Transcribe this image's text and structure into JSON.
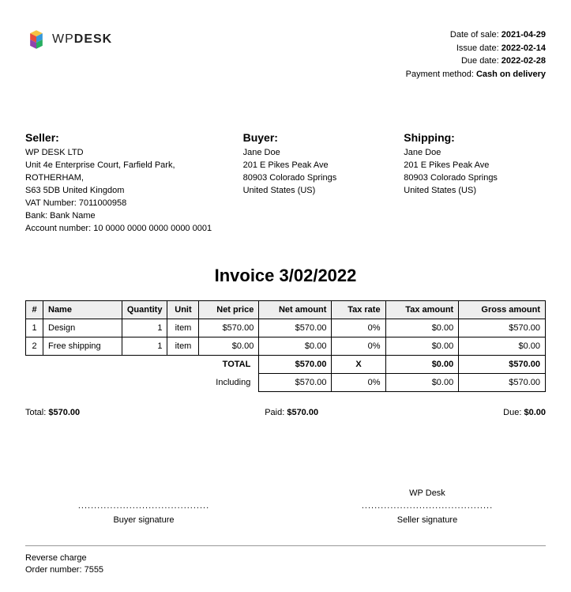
{
  "logo": {
    "brand_light": "WP",
    "brand_bold": "DESK"
  },
  "meta": {
    "date_of_sale_label": "Date of sale:",
    "date_of_sale": "2021-04-29",
    "issue_date_label": "Issue date:",
    "issue_date": "2022-02-14",
    "due_date_label": "Due date:",
    "due_date": "2022-02-28",
    "payment_method_label": "Payment method:",
    "payment_method": "Cash on delivery"
  },
  "seller": {
    "heading": "Seller:",
    "name": "WP DESK LTD",
    "address1": "Unit 4e Enterprise Court, Farfield Park, ROTHERHAM,",
    "address2": "S63 5DB United Kingdom",
    "vat": "VAT Number: 7011000958",
    "bank": "Bank: Bank Name",
    "account": "Account number: 10 0000 0000 0000 0000 0001"
  },
  "buyer": {
    "heading": "Buyer:",
    "name": "Jane Doe",
    "address1": "201 E Pikes Peak Ave",
    "address2": "80903 Colorado Springs",
    "country": "United States (US)"
  },
  "shipping": {
    "heading": "Shipping:",
    "name": "Jane Doe",
    "address1": "201 E Pikes Peak Ave",
    "address2": "80903 Colorado Springs",
    "country": "United States (US)"
  },
  "invoice_title": "Invoice 3/02/2022",
  "columns": {
    "num": "#",
    "name": "Name",
    "quantity": "Quantity",
    "unit": "Unit",
    "net_price": "Net price",
    "net_amount": "Net amount",
    "tax_rate": "Tax rate",
    "tax_amount": "Tax amount",
    "gross_amount": "Gross amount"
  },
  "items": [
    {
      "num": "1",
      "name": "Design",
      "quantity": "1",
      "unit": "item",
      "net_price": "$570.00",
      "net_amount": "$570.00",
      "tax_rate": "0%",
      "tax_amount": "$0.00",
      "gross_amount": "$570.00"
    },
    {
      "num": "2",
      "name": "Free shipping",
      "quantity": "1",
      "unit": "item",
      "net_price": "$0.00",
      "net_amount": "$0.00",
      "tax_rate": "0%",
      "tax_amount": "$0.00",
      "gross_amount": "$0.00"
    }
  ],
  "totals": {
    "total_label": "TOTAL",
    "total_net": "$570.00",
    "total_tax_rate": "X",
    "total_tax": "$0.00",
    "total_gross": "$570.00",
    "including_label": "Including",
    "including_net": "$570.00",
    "including_tax_rate": "0%",
    "including_tax": "$0.00",
    "including_gross": "$570.00"
  },
  "summary": {
    "total_label": "Total:",
    "total": "$570.00",
    "paid_label": "Paid:",
    "paid": "$570.00",
    "due_label": "Due:",
    "due": "$0.00"
  },
  "signatures": {
    "dots": ".........................................",
    "seller_name": "WP Desk",
    "buyer_label": "Buyer signature",
    "seller_label": "Seller signature"
  },
  "footer": {
    "line1": "Reverse charge",
    "line2": "Order number: 7555"
  }
}
